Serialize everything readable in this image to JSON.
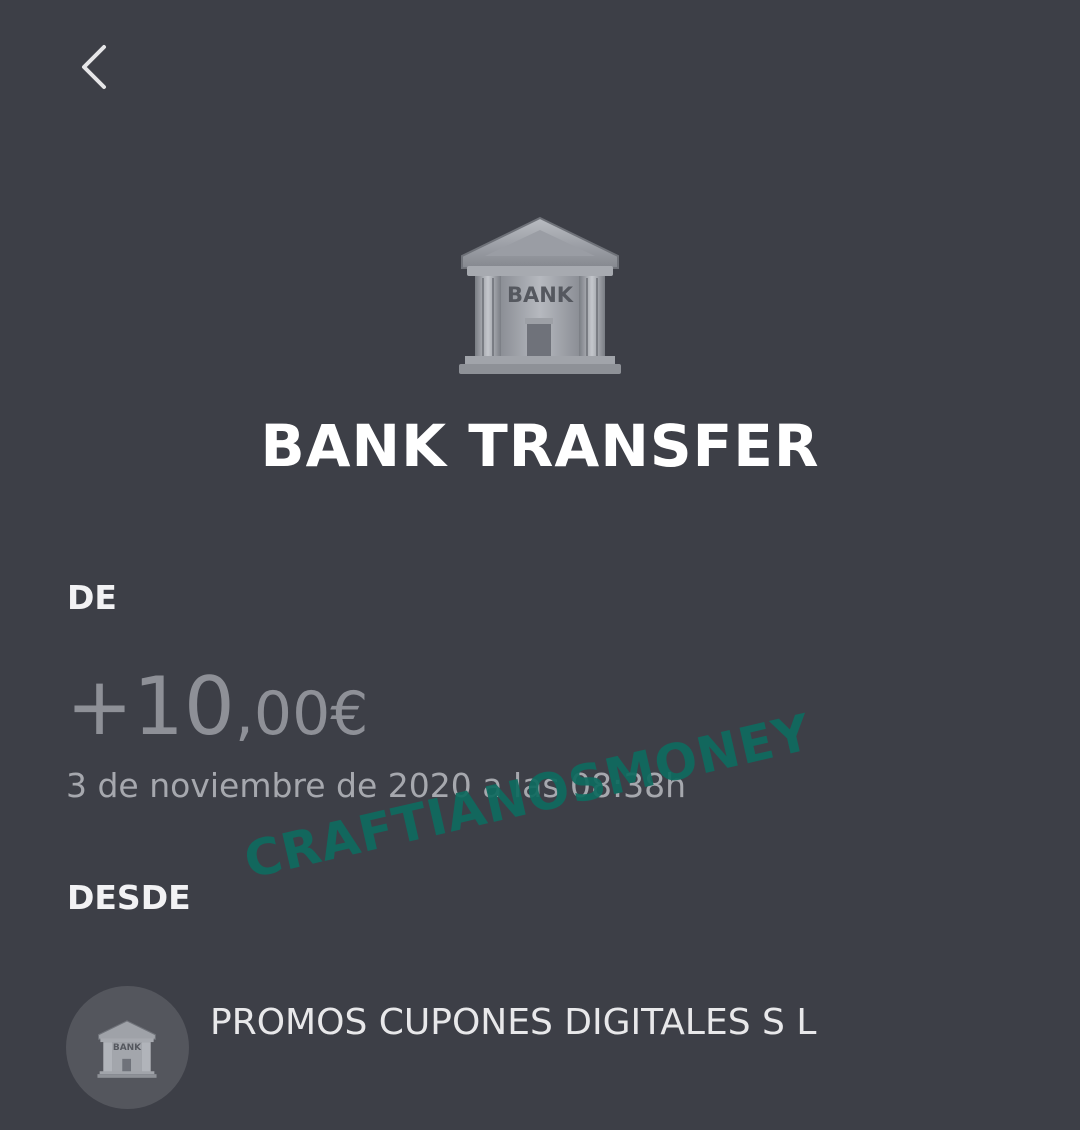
{
  "header": {
    "back_icon": "chevron-left-icon"
  },
  "transaction": {
    "icon": "bank-building-icon",
    "icon_text": "BANK",
    "title": "BANK TRANSFER",
    "direction_label": "DE",
    "amount_major": "+10",
    "amount_minor": ",00€",
    "date": "3 de noviembre de 2020 a las 08:38h",
    "from_label": "DESDE",
    "sender_name": "PROMOS CUPONES DIGITALES S L",
    "sender_icon": "bank-building-icon",
    "sender_icon_text": "BANK"
  },
  "watermark": {
    "text": "CRAFTIANOSMONEY"
  },
  "colors": {
    "background": "#3d3f47",
    "amount": "#8e9097",
    "watermark": "#0f6b5f",
    "avatar": "#54565d"
  }
}
